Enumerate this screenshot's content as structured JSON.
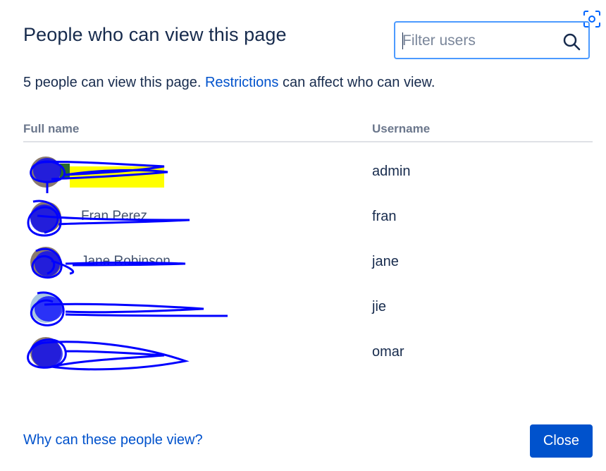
{
  "dialog": {
    "title": "People who can view this page",
    "filter_placeholder": "Filter users",
    "summary_prefix": "5 people can view this page. ",
    "summary_link": "Restrictions",
    "summary_suffix": " can affect who can view.",
    "columns": {
      "full_name": "Full name",
      "username": "Username"
    },
    "users": [
      {
        "full_name": "",
        "username": "admin"
      },
      {
        "full_name": "Fran Perez",
        "username": "fran"
      },
      {
        "full_name": "Jane Robinson",
        "username": "jane"
      },
      {
        "full_name": "",
        "username": "jie"
      },
      {
        "full_name": "",
        "username": "omar"
      }
    ],
    "footer_link": "Why can these people view?",
    "close_label": "Close"
  },
  "colors": {
    "primary": "#0052cc",
    "text": "#172b4d",
    "focus_border": "#4c9aff",
    "redaction": "#0000ff",
    "highlight": "#ffff00"
  },
  "icons": {
    "search": "search-icon",
    "corner": "focus-capture-icon"
  }
}
